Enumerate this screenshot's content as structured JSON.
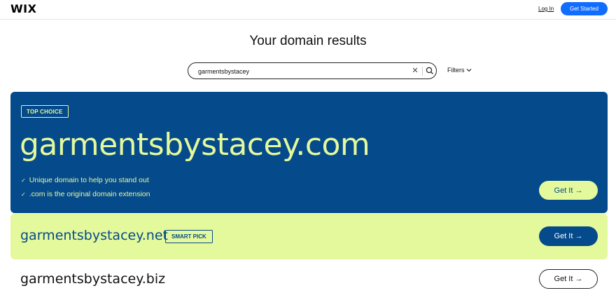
{
  "header": {
    "logo": "WIX",
    "login_label": "Log In",
    "get_started_label": "Get Started"
  },
  "page": {
    "title": "Your domain results"
  },
  "search": {
    "value": "garmentsbystacey",
    "clear_icon": "close-icon",
    "search_icon": "search-icon"
  },
  "filters": {
    "label": "Filters",
    "icon": "chevron-down-icon"
  },
  "results": [
    {
      "domain": "garmentsbystacey.com",
      "badge": "TOP CHOICE",
      "features": [
        "Unique domain to help you stand out",
        ".com is the original domain extension"
      ],
      "cta": "Get It →"
    },
    {
      "domain": "garmentsbystacey.net",
      "badge": "SMART PICK",
      "cta": "Get It →"
    },
    {
      "domain": "garmentsbystacey.biz",
      "cta": "Get It →"
    }
  ],
  "colors": {
    "accent_blue": "#116dff",
    "navy": "#054a8b",
    "lime": "#e4f99b"
  }
}
